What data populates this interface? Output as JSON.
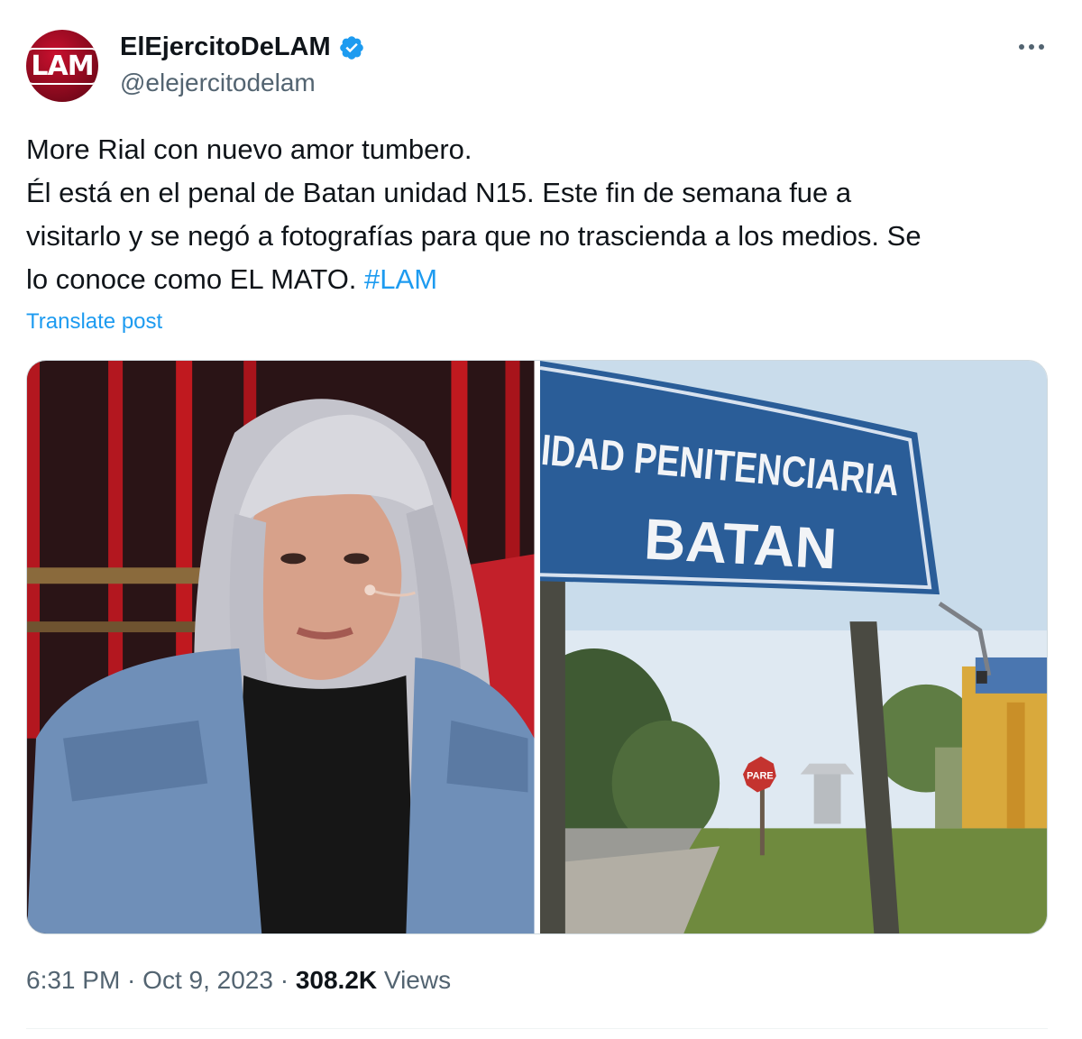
{
  "author": {
    "display_name": "ElEjercitoDeLAM",
    "handle": "@elejercitodelam",
    "avatar_text": "LAM",
    "verified": true
  },
  "tweet": {
    "lines": [
      "More Rial con nuevo amor tumbero.",
      "Él está en el penal de Batan unidad N15. Este fin de semana fue a",
      "visitarlo y se negó a fotografías para que no trascienda a los medios.  Se",
      "lo conoce como EL MATO. "
    ],
    "hashtag": "#LAM",
    "translate_label": "Translate post"
  },
  "media": {
    "left_image": "woman-with-silver-hair-denim-jacket",
    "right_image": "unidad-penitenciaria-batan-sign",
    "sign_line1": "IDAD PENITENCIARIA",
    "sign_line2": "BATAN",
    "stop_sign": "PARE"
  },
  "footer": {
    "time": "6:31 PM",
    "separator": " · ",
    "date": "Oct 9, 2023",
    "views_count": "308.2K",
    "views_label": " Views"
  },
  "colors": {
    "accent": "#1d9bf0",
    "text_primary": "#0f1419",
    "text_secondary": "#536471",
    "avatar_red": "#c8102e"
  },
  "icons": [
    "verified-badge-icon",
    "more-options-icon"
  ]
}
